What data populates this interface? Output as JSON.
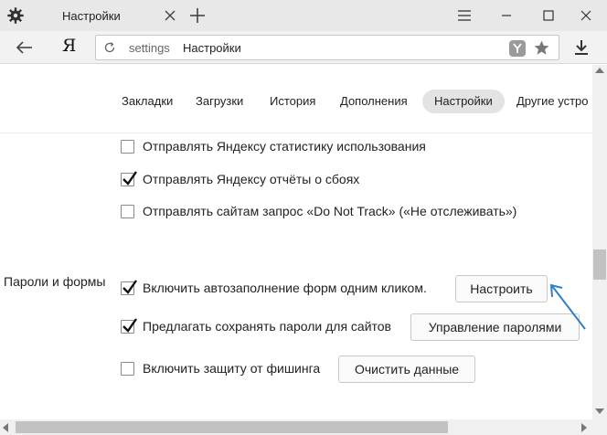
{
  "tab": {
    "title": "Настройки"
  },
  "address": {
    "scheme_text": "settings",
    "title_text": "Настройки"
  },
  "logo": "Я",
  "nav": {
    "tabs": [
      {
        "label": "Закладки"
      },
      {
        "label": "Загрузки"
      },
      {
        "label": "История"
      },
      {
        "label": "Дополнения"
      },
      {
        "label": "Настройки",
        "active": true
      },
      {
        "label": "Другие устро"
      }
    ]
  },
  "privacy": {
    "options": [
      {
        "label": "Отправлять Яндексу статистику использования",
        "checked": false
      },
      {
        "label": "Отправлять Яндексу отчёты о сбоях",
        "checked": true
      },
      {
        "label": "Отправлять сайтам запрос «Do Not Track» («Не отслеживать»)",
        "checked": false
      }
    ]
  },
  "passwords": {
    "section_label": "Пароли и формы",
    "options": [
      {
        "label": "Включить автозаполнение форм одним кликом.",
        "checked": true,
        "button": "Настроить"
      },
      {
        "label": "Предлагать сохранять пароли для сайтов",
        "checked": true,
        "button": "Управление паролями"
      },
      {
        "label": "Включить защиту от фишинга",
        "checked": false,
        "button": "Очистить данные"
      }
    ]
  },
  "icons": {
    "gear": "settings-gear-icon",
    "close": "close-icon",
    "new_tab": "plus-icon",
    "menu": "hamburger-menu-icon",
    "minimize": "minimize-icon",
    "maximize": "maximize-icon",
    "window_close": "window-close-icon",
    "back": "back-arrow-icon",
    "reload": "reload-icon",
    "protect": "protect-shield-icon",
    "star": "star-icon",
    "download": "download-icon",
    "annotation": "annotation-arrow-icon"
  },
  "colors": {
    "annotation_arrow": "#2f7fc6",
    "active_tab_bg": "#e3e3e3"
  }
}
